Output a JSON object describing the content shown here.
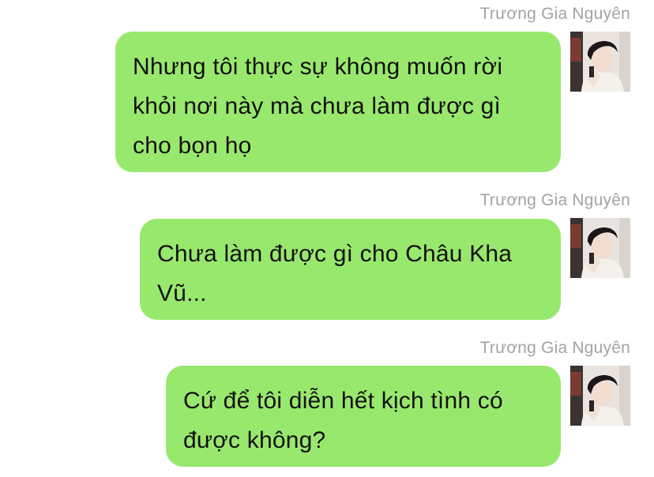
{
  "messages": [
    {
      "sender": "Trương Gia Nguyên",
      "text": "Nhưng tôi thực sự không muốn rời khỏi nơi này mà chưa làm được gì cho bọn họ",
      "avatar_icon": "profile-photo"
    },
    {
      "sender": "Trương Gia Nguyên",
      "text": "Chưa làm được gì cho Châu Kha Vũ...",
      "avatar_icon": "profile-photo"
    },
    {
      "sender": "Trương Gia Nguyên",
      "text": "Cứ để tôi diễn hết kịch tình có được không?",
      "avatar_icon": "profile-photo"
    }
  ],
  "colors": {
    "bubble": "#99e86e",
    "sender_name": "#a3a3a3",
    "text": "#111111",
    "background": "#ffffff"
  }
}
